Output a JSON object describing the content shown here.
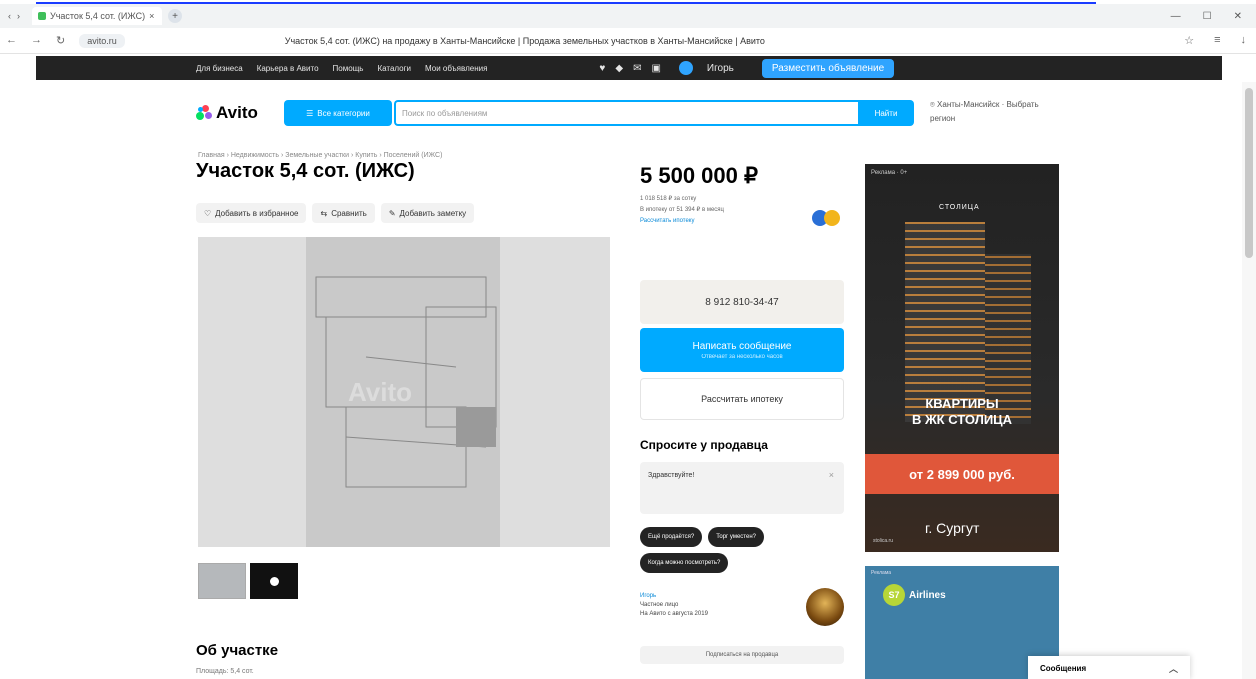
{
  "browser": {
    "tab_title": "Участок 5,4 сот. (ИЖС)",
    "url_chip": "avito.ru",
    "page_title": "Участок 5,4 сот. (ИЖС) на продажу в Ханты-Мансийске | Продажа земельных участков в Ханты-Мансийске | Авито",
    "window_controls": [
      "—",
      "☐",
      "✕"
    ]
  },
  "sitebar": {
    "links": [
      "Для бизнеса",
      "Карьера в Авито",
      "Помощь",
      "Каталоги",
      "Мои объявления"
    ],
    "user_name": "Игорь",
    "place_ad": "Разместить объявление"
  },
  "header": {
    "logo": "Avito",
    "categories": "Все категории",
    "search_placeholder": "Поиск по объявлениям",
    "search_button": "Найти",
    "location": "Ханты-Мансийск · Выбрать регион"
  },
  "listing": {
    "breadcrumbs": "Главная › Недвижимость › Земельные участки › Купить › Поселений (ИЖС)",
    "title": "Участок 5,4 сот. (ИЖС)",
    "actions": [
      {
        "icon": "heart-icon",
        "label": "Добавить в избранное"
      },
      {
        "icon": "compare-icon",
        "label": "Сравнить"
      },
      {
        "icon": "note-icon",
        "label": "Добавить заметку"
      }
    ],
    "watermark": "Avito",
    "about_heading": "Об участке",
    "about_sub": "Площадь: 5,4 сот."
  },
  "sidebar": {
    "price": "5 500 000 ₽",
    "price_meta_1": "1 018 518 ₽ за сотку",
    "price_meta_2": "В ипотеку от 51 394 ₽ в месяц",
    "price_meta_link": "Рассчитать ипотеку",
    "phone": "8 912 810-34-47",
    "write_message": "Написать сообщение",
    "write_message_sub": "Отвечает за несколько часов",
    "calc_mortgage": "Рассчитать ипотеку",
    "ask_heading": "Спросите у продавца",
    "ask_input": "Здравствуйте!",
    "chips": [
      "Ещё продаётся?",
      "Торг уместен?",
      "Когда можно посмотреть?"
    ],
    "seller_name": "Игорь",
    "seller_type": "Частное лицо",
    "seller_since": "На Авито с августа 2019",
    "subscribe": "Подписаться на продавца"
  },
  "ads": {
    "ad1_label": "Реклама · 0+",
    "ad1_brand": "СТОЛИЦА",
    "ad1_headline_1": "КВАРТИРЫ",
    "ad1_headline_2": "В ЖК СТОЛИЦА",
    "ad1_price": "от 2 899 000 руб.",
    "ad1_city": "г. Сургут",
    "ad1_small": "stolica.ru",
    "ad2_label": "Реклама",
    "ad2_name": "Airlines"
  },
  "messages_popup": "Сообщения",
  "colors": {
    "accent": "#00aaff",
    "dark": "#232323",
    "ad_red": "#e0573a"
  }
}
